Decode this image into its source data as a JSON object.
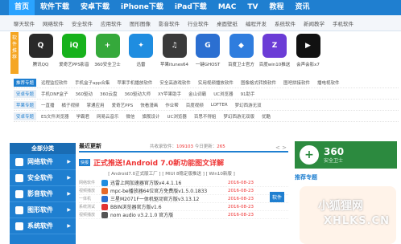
{
  "topnav": [
    "首页",
    "软件下载",
    "安卓下载",
    "iPhone下载",
    "iPad下载",
    "MAC",
    "TV",
    "教程",
    "资讯"
  ],
  "subnav": [
    "聊天软件",
    "网络软件",
    "安全软件",
    "应用软件",
    "图形图像",
    "影音软件",
    "行业软件",
    "桌面壁纸",
    "编程开发",
    "系统软件",
    "新闻教学",
    "手机软件"
  ],
  "logo_strip": "软件推荐",
  "apps": [
    {
      "label": "腾讯QQ",
      "color": "#2a2a2a",
      "glyph": "Q"
    },
    {
      "label": "爱奇艺PPS影音",
      "color": "#17b21c",
      "glyph": "iQ"
    },
    {
      "label": "360安全卫士",
      "color": "#35a93b",
      "glyph": "+"
    },
    {
      "label": "迅雷",
      "color": "#1f8de0",
      "glyph": "✦"
    },
    {
      "label": "苹果itunes64",
      "color": "#3a3a3a",
      "glyph": "♫"
    },
    {
      "label": "一键GHOST",
      "color": "#2b6fd1",
      "glyph": "G"
    },
    {
      "label": "百度卫士官方",
      "color": "#2f7dde",
      "glyph": "◆"
    },
    {
      "label": "百度win10推送",
      "color": "#6b3cd6",
      "glyph": "Z"
    },
    {
      "label": "会声会影x7",
      "color": "#111111",
      "glyph": "▶"
    },
    {
      "label": "",
      "color": "#ffffff",
      "glyph": ""
    },
    {
      "label": "",
      "color": "#ffffff",
      "glyph": ""
    }
  ],
  "tagrows": [
    {
      "badge": "推荐专题",
      "items": [
        "远程监控软件",
        "手机盒子app合集",
        "苹果手机播放软件",
        "安全高游戏软件",
        "实用视频播放软件",
        "图像格式转换软件",
        "图吧拼接软件",
        "播电视软件"
      ]
    },
    {
      "badge": "安卓专题",
      "items": [
        "手机DNF盒子",
        "360驱动",
        "360云盘",
        "360驱动大师",
        "XY苹果助手",
        "金山词霸",
        "UC浏览器",
        "91助手"
      ]
    },
    {
      "badge": "苹果专题",
      "items": [
        "一直播",
        "橘子视频",
        "掌通应用",
        "爱奇艺PPS",
        "快看漫画",
        "作业帮",
        "百度视频",
        "LOFTER",
        "梦幻西游无双"
      ]
    },
    {
      "badge": "安卓专题",
      "items": [
        "ES文件浏览器",
        "学霸君",
        "网易云音乐",
        "微信",
        "旗舰设计",
        "UC浏览器",
        "百思不得姐",
        "梦幻西游无双版",
        "优酷"
      ]
    }
  ],
  "sidebar": {
    "title": "全部分类",
    "items": [
      "网络软件",
      "安全软件",
      "影音软件",
      "图形软件",
      "系统软件"
    ]
  },
  "latest": {
    "title": "最近更新",
    "stats_prefix": "共收录软件：",
    "count": "109103",
    "today_prefix": "今日更新：",
    "today": "265",
    "headline_badge": "快报",
    "headline": "正式推送!Android 7.0新功能图文详解",
    "subline": "[ Android7.0正式版工厂 ] [ MIUI 8稳定版推送 ] [ Win10新版 ]",
    "rows": [
      {
        "cat": "网络软件",
        "icon_color": "#1f8de0",
        "name": "迅雷上网加速器官方版v4.4.1.16",
        "date": "2016-08-23"
      },
      {
        "cat": "视频播放",
        "icon_color": "#e86b2b",
        "name": "mpc-be播放器64位官方免费版v1.5.0.1833",
        "date": "2016-08-23"
      },
      {
        "cat": "一体机",
        "icon_color": "#2b6fd1",
        "name": "三星M2071F一体机驱动官方版v3.13.12",
        "date": "2016-08-23"
      },
      {
        "cat": "系统测试",
        "icon_color": "#e33333",
        "name": "BBIN浏览器官方版v1.6",
        "date": "2016-08-23"
      },
      {
        "cat": "视频播放",
        "icon_color": "#555555",
        "name": "nom audio v3.2.1.0 官方版",
        "date": "2016-08-23"
      }
    ],
    "side_tag": "软件"
  },
  "pager": "< >",
  "ad": {
    "title": "360",
    "subtitle": "安全卫士"
  },
  "recommend": "推荐专题",
  "watermark": {
    "line1": "小狐狸网",
    "line2": "XHLKS.CN"
  }
}
